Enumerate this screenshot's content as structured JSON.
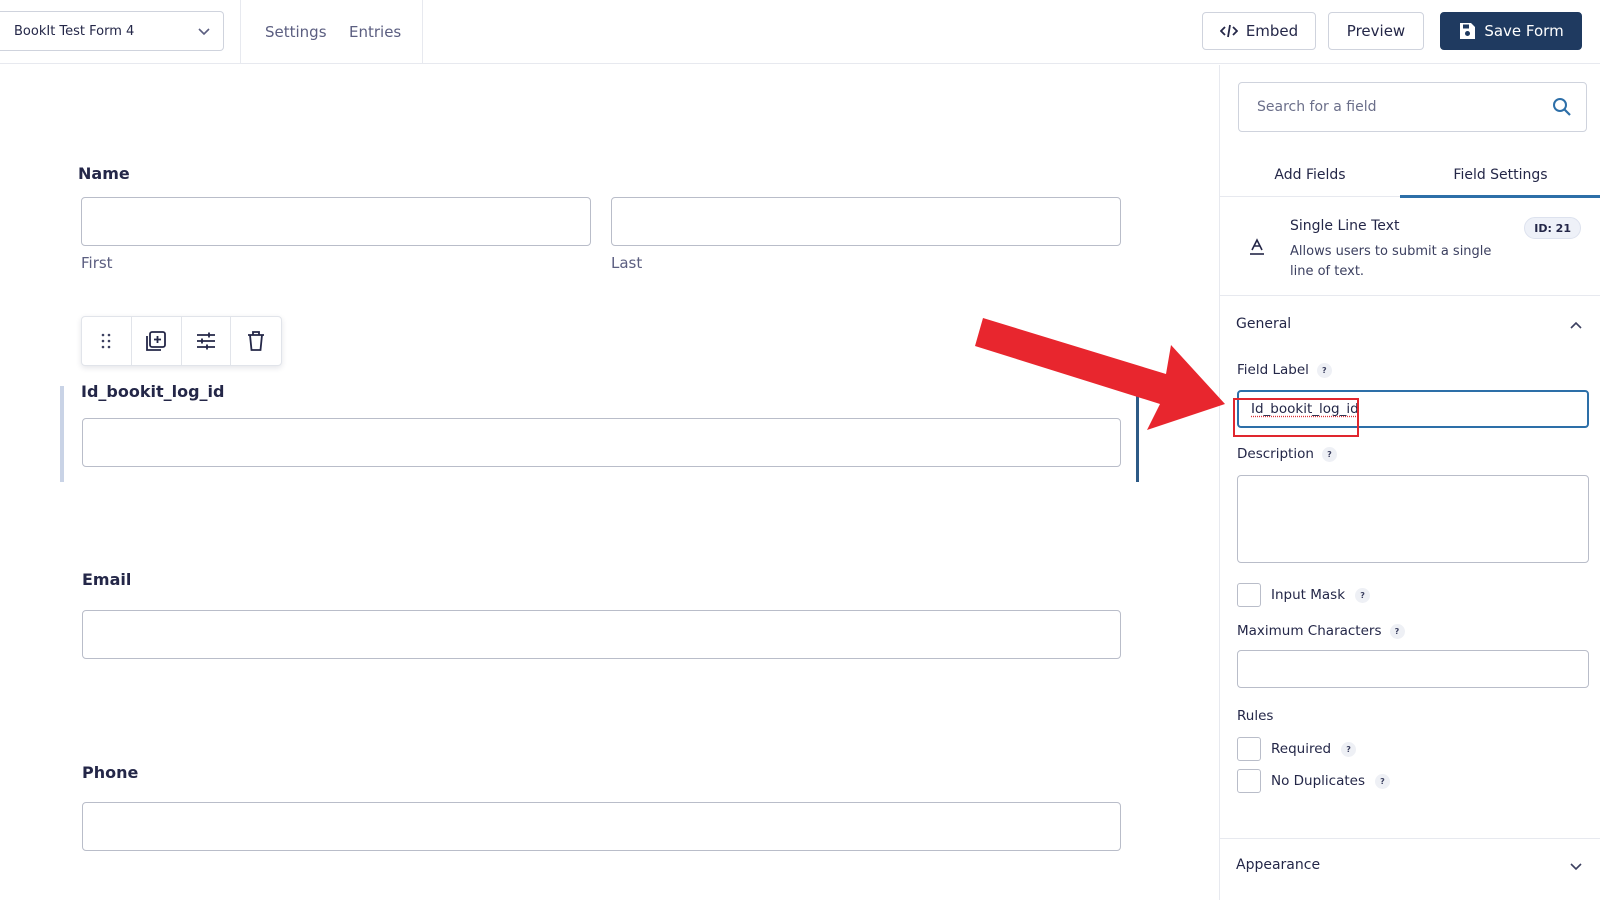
{
  "header": {
    "form_name": "BookIt Test Form 4",
    "nav": [
      "Settings",
      "Entries"
    ],
    "embed_label": "Embed",
    "preview_label": "Preview",
    "save_label": "Save Form"
  },
  "canvas": {
    "name_field": {
      "label": "Name",
      "sub_first": "First",
      "sub_last": "Last"
    },
    "selected_field": {
      "label": "Id_bookit_log_id"
    },
    "email_field": {
      "label": "Email"
    },
    "phone_field": {
      "label": "Phone"
    }
  },
  "sidebar": {
    "search_placeholder": "Search for a field",
    "tabs": [
      "Add Fields",
      "Field Settings"
    ],
    "active_tab": "Field Settings",
    "field_info": {
      "title": "Single Line Text",
      "description": "Allows users to submit a single line of text.",
      "id_badge": "ID: 21"
    },
    "general": {
      "title": "General",
      "field_label_label": "Field Label",
      "field_label_value": "Id_bookit_log_id",
      "description_label": "Description",
      "input_mask_label": "Input Mask",
      "max_chars_label": "Maximum Characters",
      "rules_label": "Rules",
      "required_label": "Required",
      "no_duplicates_label": "No Duplicates",
      "help_glyph": "?"
    },
    "appearance": {
      "title": "Appearance"
    }
  },
  "colors": {
    "primary": "#1f3a60",
    "accent": "#2d6fa8",
    "annotation": "#e0262e"
  },
  "icons": [
    "chevron-down-icon",
    "code-icon",
    "save-icon",
    "drag-handle-icon",
    "duplicate-icon",
    "settings-sliders-icon",
    "trash-icon",
    "search-icon",
    "text-field-icon",
    "chevron-up-icon",
    "arrow-annotation"
  ]
}
